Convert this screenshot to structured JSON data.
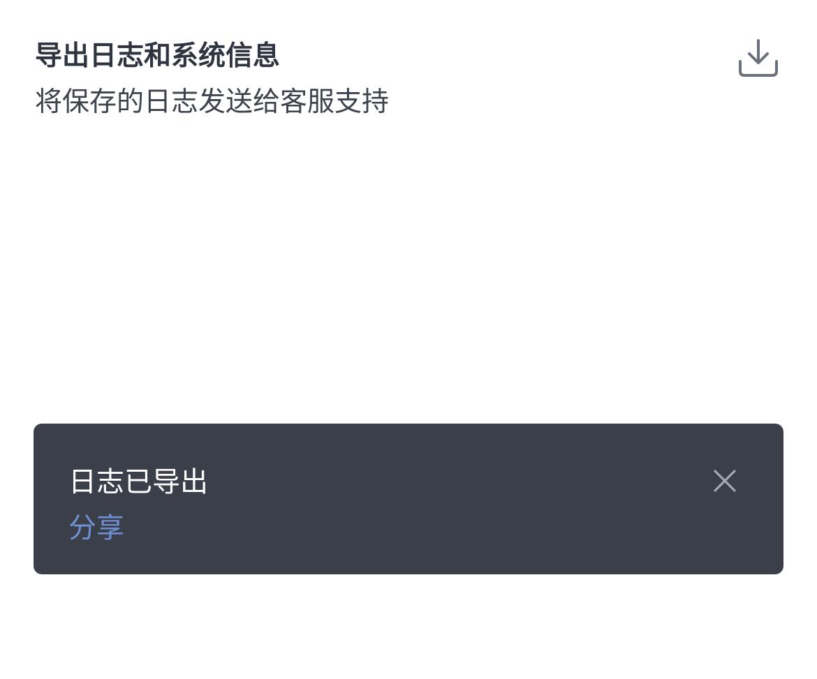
{
  "export_logs": {
    "title": "导出日志和系统信息",
    "subtitle": "将保存的日志发送给客服支持",
    "icon": "download-icon"
  },
  "toast": {
    "message": "日志已导出",
    "action_label": "分享",
    "close_icon": "close-icon",
    "colors": {
      "background": "#3a3f4a",
      "message": "#ffffff",
      "action": "#6f8fd1",
      "close": "#a5a9b1"
    }
  },
  "colors": {
    "title": "#2f3540",
    "subtitle": "#3d434d",
    "icon": "#6b717c",
    "page_background": "#ffffff"
  }
}
